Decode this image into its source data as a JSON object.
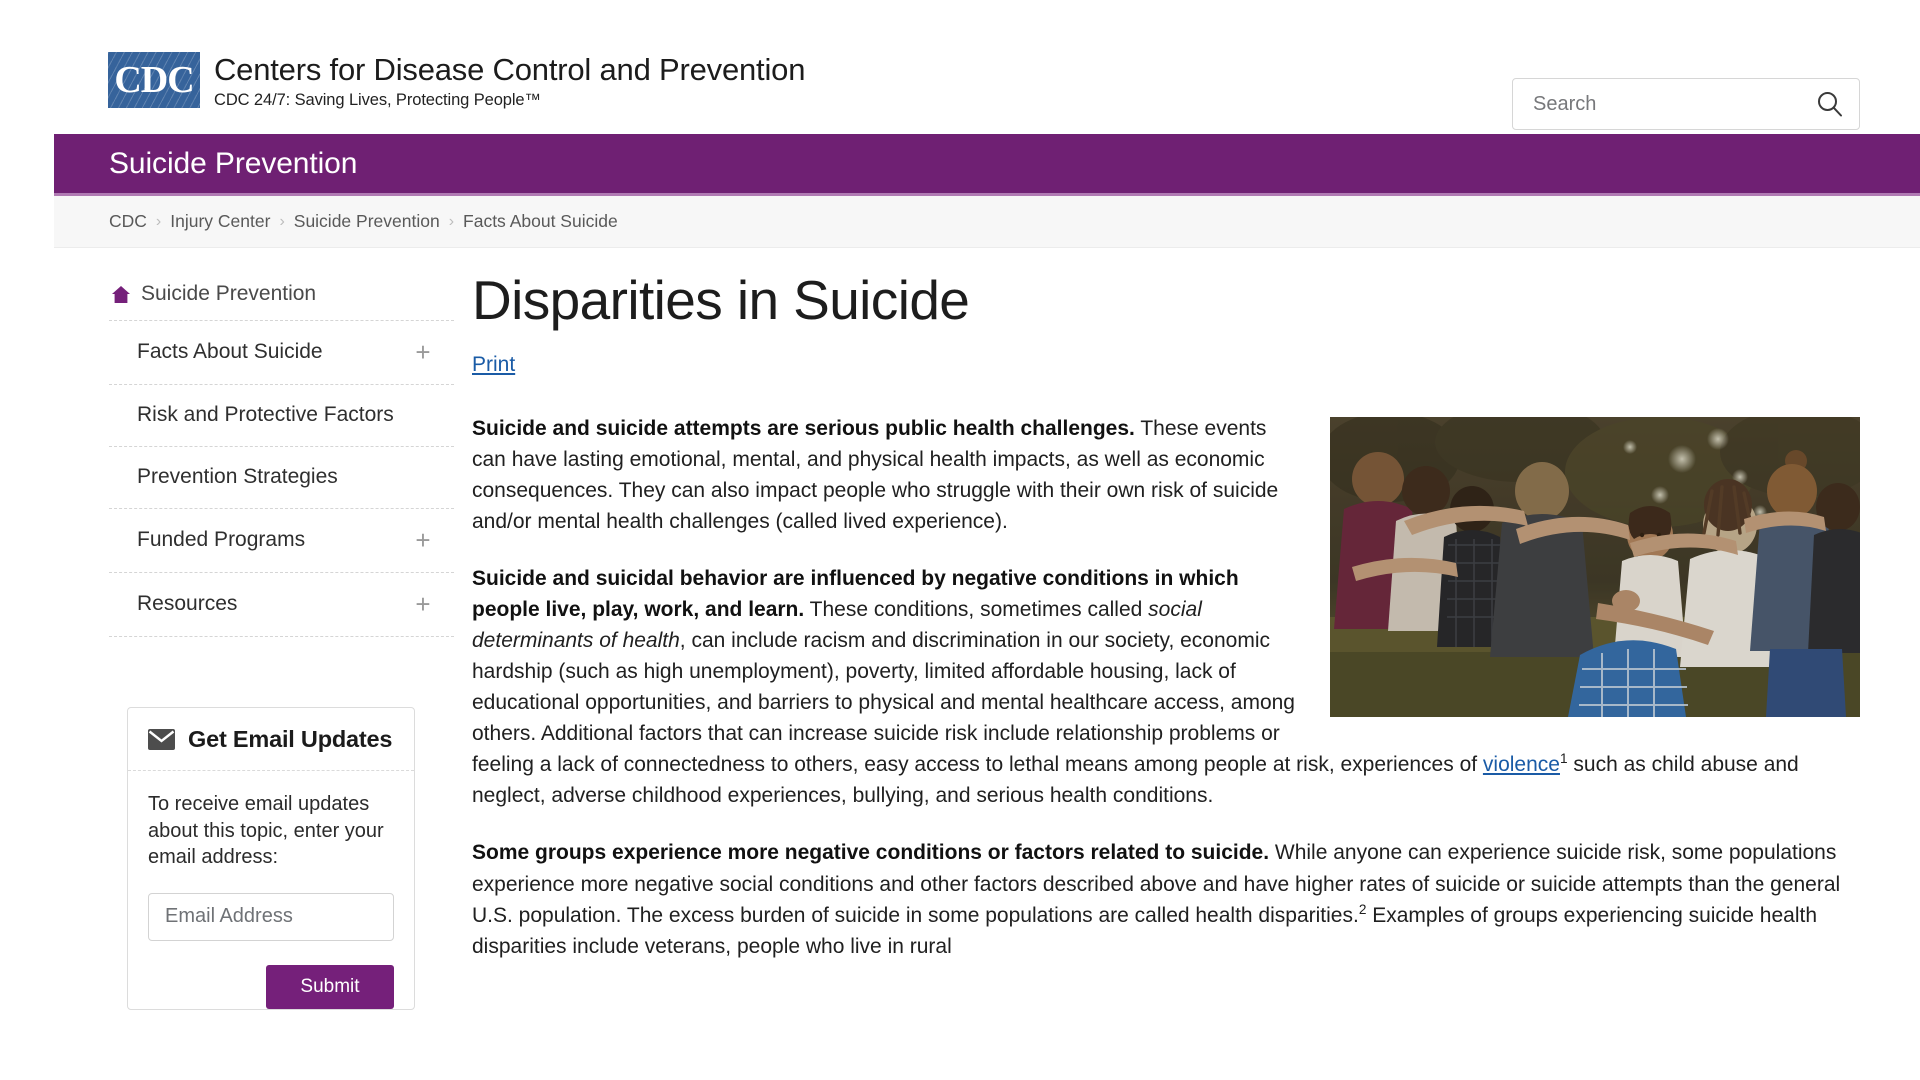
{
  "header": {
    "logo_mark": "CDC",
    "agency_name": "Centers for Disease Control and Prevention",
    "tagline": "CDC 24/7: Saving Lives, Protecting People™",
    "search_placeholder": "Search",
    "search_value": ""
  },
  "banner": {
    "title": "Suicide Prevention",
    "color": "#6f2073"
  },
  "breadcrumb": {
    "items": [
      "CDC",
      "Injury Center",
      "Suicide Prevention",
      "Facts About Suicide"
    ],
    "separator": "›"
  },
  "sidebar": {
    "home_label": "Suicide Prevention",
    "items": [
      {
        "label": "Facts About Suicide",
        "expandable": true,
        "toggle": "+"
      },
      {
        "label": "Risk and Protective Factors",
        "expandable": false,
        "toggle": ""
      },
      {
        "label": "Prevention Strategies",
        "expandable": false,
        "toggle": ""
      },
      {
        "label": "Funded Programs",
        "expandable": true,
        "toggle": "+"
      },
      {
        "label": "Resources",
        "expandable": true,
        "toggle": "+"
      }
    ],
    "email_card": {
      "title": "Get Email Updates",
      "description": "To receive email updates about this topic, enter your email address:",
      "input_placeholder": "Email Address",
      "input_value": "",
      "submit_label": "Submit"
    }
  },
  "main": {
    "page_title": "Disparities in Suicide",
    "print_label": "Print",
    "image_alt": "Group of diverse young people standing outdoors in a supportive huddle with arms around each other",
    "paragraphs": [
      {
        "lead": "Suicide and suicide attempts are serious public health challenges.",
        "body": " These events can have lasting emotional, mental, and physical health impacts, as well as economic consequences. They can also impact people who struggle with their own risk of suicide and/or mental health challenges (called lived experience)."
      },
      {
        "lead": "Suicide and suicidal behavior are influenced by negative conditions in which people live, play, work, and learn.",
        "body_1": " These conditions, sometimes called ",
        "italic": "social determinants of health",
        "body_2": ", can include racism and discrimination in our society, economic hardship (such as high unemployment), poverty, limited affordable housing, lack of educational opportunities, and barriers to physical and mental healthcare access, among others. Additional factors that can increase suicide risk include relationship problems or feeling a lack of connectedness to others, easy access to lethal means among people at risk, experiences of ",
        "link": "violence",
        "link_ref": "1",
        "body_3": " such as child abuse and neglect, adverse childhood experiences, bullying, and serious health conditions."
      },
      {
        "lead": "Some groups experience more negative conditions or factors related to suicide.",
        "body_1": " While anyone can experience suicide risk, some populations experience more negative social conditions and other factors described above and have higher rates of suicide or suicide attempts than the general U.S. population. The excess burden of suicide in some populations are called health disparities.",
        "ref": "2",
        "body_2": " Examples of groups experiencing suicide health disparities include veterans, people who live in rural"
      }
    ]
  }
}
